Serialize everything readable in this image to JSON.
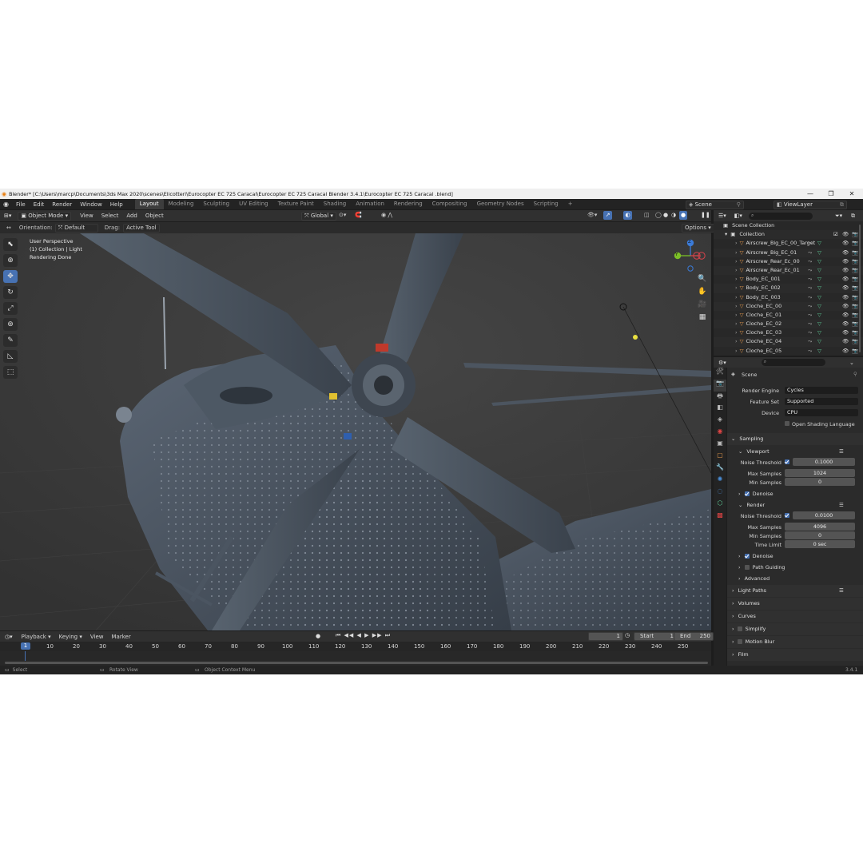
{
  "window": {
    "title": "Blender* [C:\\Users\\marcp\\Documents\\3ds Max 2020\\scenes\\Elicotteri\\Eurocopter EC 725 Caracal\\Eurocopter EC 725 Caracal Blender 3.4.1\\Eurocopter EC 725 Caracal .blend]",
    "minimize": "—",
    "maximize": "❐",
    "close": "✕"
  },
  "menu": {
    "items": [
      "File",
      "Edit",
      "Render",
      "Window",
      "Help"
    ]
  },
  "workspaces": [
    "Layout",
    "Modeling",
    "Sculpting",
    "UV Editing",
    "Texture Paint",
    "Shading",
    "Animation",
    "Rendering",
    "Compositing",
    "Geometry Nodes",
    "Scripting"
  ],
  "workspace_add": "+",
  "scene_selector": {
    "value": "Scene"
  },
  "viewlayer_selector": {
    "value": "ViewLayer"
  },
  "viewport_header": {
    "mode": "Object Mode",
    "menus": [
      "View",
      "Select",
      "Add",
      "Object"
    ],
    "transform_orientation": "Global",
    "orientation_label": "Orientation:",
    "orientation_value": "Default",
    "drag_label": "Drag:",
    "drag_value": "Active Tool",
    "options": "Options"
  },
  "viewport_info": {
    "line1": "User Perspective",
    "line2": "(1) Collection | Light",
    "line3": "Rendering Done"
  },
  "gizmo": {
    "z": "Z",
    "y": "Y"
  },
  "timeline": {
    "menus": [
      "Playback",
      "Keying",
      "View",
      "Marker"
    ],
    "current_frame": "1",
    "start_label": "Start",
    "start": "1",
    "end_label": "End",
    "end": "250",
    "ticks": [
      "1",
      "10",
      "20",
      "30",
      "40",
      "50",
      "60",
      "70",
      "80",
      "90",
      "100",
      "110",
      "120",
      "130",
      "140",
      "150",
      "160",
      "170",
      "180",
      "190",
      "200",
      "210",
      "220",
      "230",
      "240",
      "250"
    ]
  },
  "statusbar": {
    "select": "Select",
    "rotate": "Rotate View",
    "context": "Object Context Menu",
    "version": "3.4.1"
  },
  "outliner": {
    "root": "Scene Collection",
    "collection": "Collection",
    "items": [
      "Airscrew_Big_EC_00_Target",
      "Airscrew_Big_EC_01",
      "Airscrew_Rear_Ec_00",
      "Airscrew_Rear_Ec_01",
      "Body_EC_001",
      "Body_EC_002",
      "Body_EC_003",
      "Cloche_EC_00",
      "Cloche_EC_01",
      "Cloche_EC_02",
      "Cloche_EC_03",
      "Cloche_EC_04",
      "Cloche_EC_05"
    ]
  },
  "properties": {
    "context": "Scene",
    "render_engine_label": "Render Engine",
    "render_engine": "Cycles",
    "feature_set_label": "Feature Set",
    "feature_set": "Supported",
    "device_label": "Device",
    "device": "CPU",
    "osl_label": "Open Shading Language",
    "sampling": "Sampling",
    "viewport": "Viewport",
    "vp_noise_label": "Noise Threshold",
    "vp_noise": "0.1000",
    "vp_max_label": "Max Samples",
    "vp_max": "1024",
    "vp_min_label": "Min Samples",
    "vp_min": "0",
    "vp_denoise": "Denoise",
    "render": "Render",
    "r_noise_label": "Noise Threshold",
    "r_noise": "0.0100",
    "r_max_label": "Max Samples",
    "r_max": "4096",
    "r_min_label": "Min Samples",
    "r_min": "0",
    "r_time_label": "Time Limit",
    "r_time": "0 sec",
    "r_denoise": "Denoise",
    "path_guiding": "Path Guiding",
    "advanced": "Advanced",
    "light_paths": "Light Paths",
    "volumes": "Volumes",
    "curves": "Curves",
    "simplify": "Simplify",
    "motion_blur": "Motion Blur",
    "film": "Film"
  },
  "colors": {
    "accent": "#4772b3",
    "panel": "#2b2b2b",
    "header": "#303030",
    "viewport": "#3a3a3a",
    "object_icon": "#e89a4c",
    "mesh_icon": "#5fd09a",
    "helicopter": "#4a5563"
  }
}
